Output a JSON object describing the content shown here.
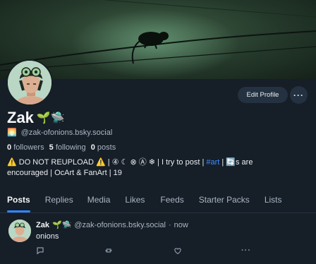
{
  "profile": {
    "display_name": "Zak",
    "name_emojis": "🌱🛸",
    "handle_emoji": "🌅",
    "handle": "@zak-ofonions.bsky.social",
    "followers_count": "0",
    "followers_label": "followers",
    "following_count": "5",
    "following_label": "following",
    "posts_count": "0",
    "posts_label": "posts",
    "bio_line1": "⚠️ DO NOT REUPLOAD ⚠️ | ④ ☾ ⊗ Ⓐ ❄ | I try to post |",
    "bio_link": "#art",
    "bio_line1_end": "| 🔄s are",
    "bio_line2": "encouraged | OcArt & FanArt | 19"
  },
  "actions": {
    "edit_profile": "Edit Profile",
    "more": "···"
  },
  "tabs": [
    "Posts",
    "Replies",
    "Media",
    "Likes",
    "Feeds",
    "Starter Packs",
    "Lists"
  ],
  "active_tab": "Posts",
  "post": {
    "author": "Zak",
    "author_emojis": "🌱🛸",
    "handle": "@zak-ofonions.bsky.social",
    "separator": "·",
    "time": "now",
    "text": "onions",
    "more": "···"
  },
  "colors": {
    "background": "#161e27",
    "accent": "#2f86ff",
    "link": "#3f8cff",
    "muted_text": "#a9b6c4"
  },
  "icons": [
    "reply-icon",
    "repost-icon",
    "like-icon",
    "more-icon"
  ]
}
